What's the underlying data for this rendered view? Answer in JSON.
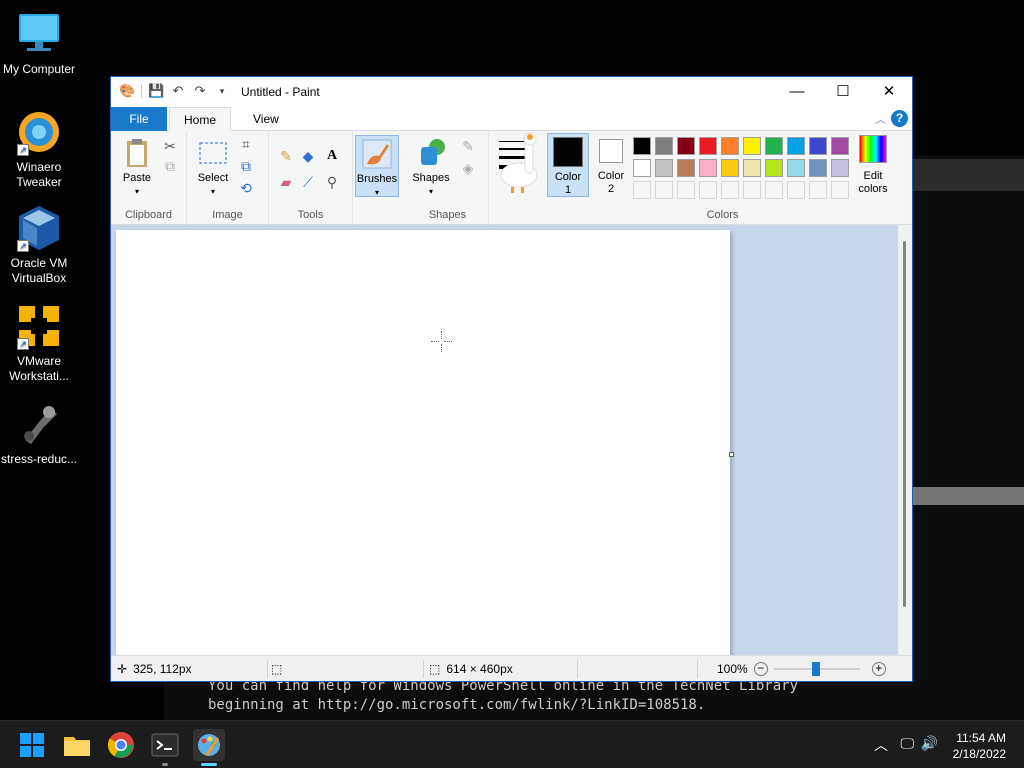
{
  "desktop": {
    "icons": [
      {
        "label": "My Computer",
        "icon": "monitor-icon"
      },
      {
        "label": "Winaero\nTweaker",
        "icon": "winaero-icon"
      },
      {
        "label": "Oracle VM\nVirtualBox",
        "icon": "virtualbox-icon"
      },
      {
        "label": "VMware\nWorkstati...",
        "icon": "vmware-icon"
      },
      {
        "label": "stress-reduc...",
        "icon": "stress-icon"
      }
    ]
  },
  "terminal": {
    "lines": [
      "You can find help for Windows PowerShell online in the TechNet Library",
      "beginning at http://go.microsoft.com/fwlink/?LinkID=108518."
    ]
  },
  "paint": {
    "title": "Untitled - Paint",
    "tabs": {
      "file": "File",
      "home": "Home",
      "view": "View"
    },
    "help_label": "?",
    "groups": {
      "clipboard": {
        "label": "Clipboard",
        "paste": "Paste"
      },
      "image": {
        "label": "Image",
        "select": "Select"
      },
      "tools": {
        "label": "Tools"
      },
      "brushes": {
        "label": "Brushes"
      },
      "shapes": {
        "label": "Shapes",
        "shapes_btn": "Shapes"
      },
      "colors": {
        "label": "Colors",
        "color1": "Color\n1",
        "color2": "Color\n2",
        "edit_colors": "Edit\ncolors"
      }
    },
    "color1_value": "#000000",
    "color2_value": "#ffffff",
    "palette_row1": [
      "#000000",
      "#7f7f7f",
      "#880015",
      "#ed1c24",
      "#ff7f27",
      "#fff200",
      "#22b14c",
      "#00a2e8",
      "#3f48cc",
      "#a349a4"
    ],
    "palette_row2": [
      "#ffffff",
      "#c3c3c3",
      "#b97a57",
      "#ffaec9",
      "#ffc90e",
      "#efe4b0",
      "#b5e61d",
      "#99d9ea",
      "#7092be",
      "#c8bfe7"
    ],
    "status": {
      "cursor_pos": "325, 112px",
      "canvas_size": "614 × 460px",
      "zoom": "100%"
    }
  },
  "taskbar": {
    "apps": [
      "start-icon",
      "file-explorer-icon",
      "chrome-icon",
      "terminal-icon",
      "paint-icon"
    ],
    "time": "11:54 AM",
    "date": "2/18/2022"
  }
}
